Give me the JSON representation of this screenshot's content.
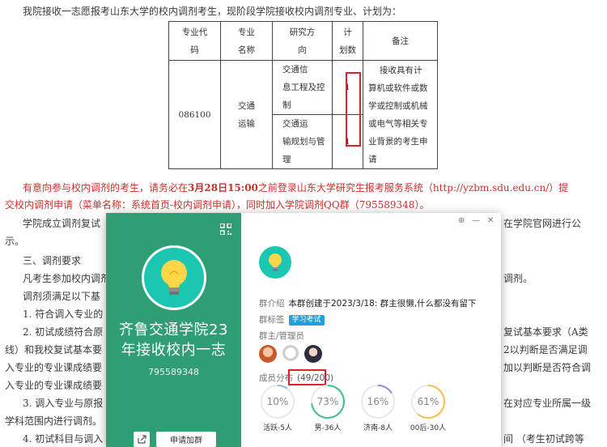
{
  "doc": {
    "intro": "我院接收一志愿报考山东大学的校内调剂考生，现阶段学院接收校内调剂专业、计划为：",
    "table": {
      "headers": {
        "code": [
          "专业代",
          "码"
        ],
        "name": [
          "专业",
          "名称"
        ],
        "direction": [
          "研究方",
          "向"
        ],
        "plan": [
          "计",
          "划数"
        ],
        "remark": "备注"
      },
      "code": "086100",
      "name": [
        "交通",
        "运输"
      ],
      "rows": [
        {
          "direction": [
            "交通信",
            "息工程及控",
            "制"
          ],
          "plan": "1"
        },
        {
          "direction": [
            "交通运",
            "输规划与管",
            "理"
          ],
          "plan": "1"
        }
      ],
      "remark": [
        "接收具有计",
        "算机或软件或数",
        "学或控制或机械",
        "或电气等相关专",
        "业背景的考生申",
        "请"
      ]
    },
    "notice_line1_a": "有意向参与校内调剂的考生，请务必在",
    "notice_line1_date": "3月28日15:00",
    "notice_line1_b": "之前登录山东大学研究生报考服务系统（http://yzbm.sdu.edu.cn/）提",
    "notice_line2": "交校内调剂申请（菜单名称：系统首页-校内调剂申请），同时加入学院调剂QQ群（795589348）。",
    "p_a_left": "学院成立调剂复试",
    "p_a_right": "在学院官网进行公",
    "p_b_left": "示。",
    "p_c_left": "三、调剂要求",
    "p_d_left": "凡考生参加校内调剂的",
    "p_d_right": "调剂。",
    "p_e_left": "调剂须满足以下基",
    "p_f_left": "1. 符合调入专业的",
    "p_g_left": "2. 初试成绩符合原",
    "p_g_right": "复试基本要求（A类",
    "p_h_left": "线）和我校复试基本要",
    "p_h_right": "2以判断是否满足调",
    "p_i_left": "入专业的专业课成绩要",
    "p_i_right": "加以判断是否符合调",
    "p_j_left": "入专业的专业课成绩要",
    "p_k_left": "3. 调入专业与原报",
    "p_k_right": "在对应专业所属一级",
    "p_l_left": "学科范围内进行调剂。",
    "p_m_left": "4. 初试科目与调入",
    "p_m_right": "间 （考生初试跨等"
  },
  "card": {
    "group_name_line1": "齐鲁交通学院23",
    "group_name_line2": "年接收校内一志",
    "group_id": "795589348",
    "join_label": "申请加群",
    "intro_key": "群介绍",
    "intro_value": "本群创建于2023/3/18: 群主很懒,什么都没有留下",
    "tag_key": "群标签",
    "tag_value": "学习考试",
    "admin_key": "群主/管理员",
    "members_key": "成员分布",
    "members_value": "(49/200)",
    "stats": [
      {
        "percent": "10%",
        "value": 10,
        "label": "活跃-5人",
        "color": "#8fb8e8"
      },
      {
        "percent": "73%",
        "value": 73,
        "label": "男-36人",
        "color": "#3ec08a"
      },
      {
        "percent": "16%",
        "value": 16,
        "label": "济南-8人",
        "color": "#9a86e0"
      },
      {
        "percent": "61%",
        "value": 61,
        "label": "00后-30人",
        "color": "#f2c14e"
      }
    ]
  },
  "colors": {
    "accent": "#2f9e72",
    "highlight": "#d9232d",
    "notice": "#c9302c"
  }
}
